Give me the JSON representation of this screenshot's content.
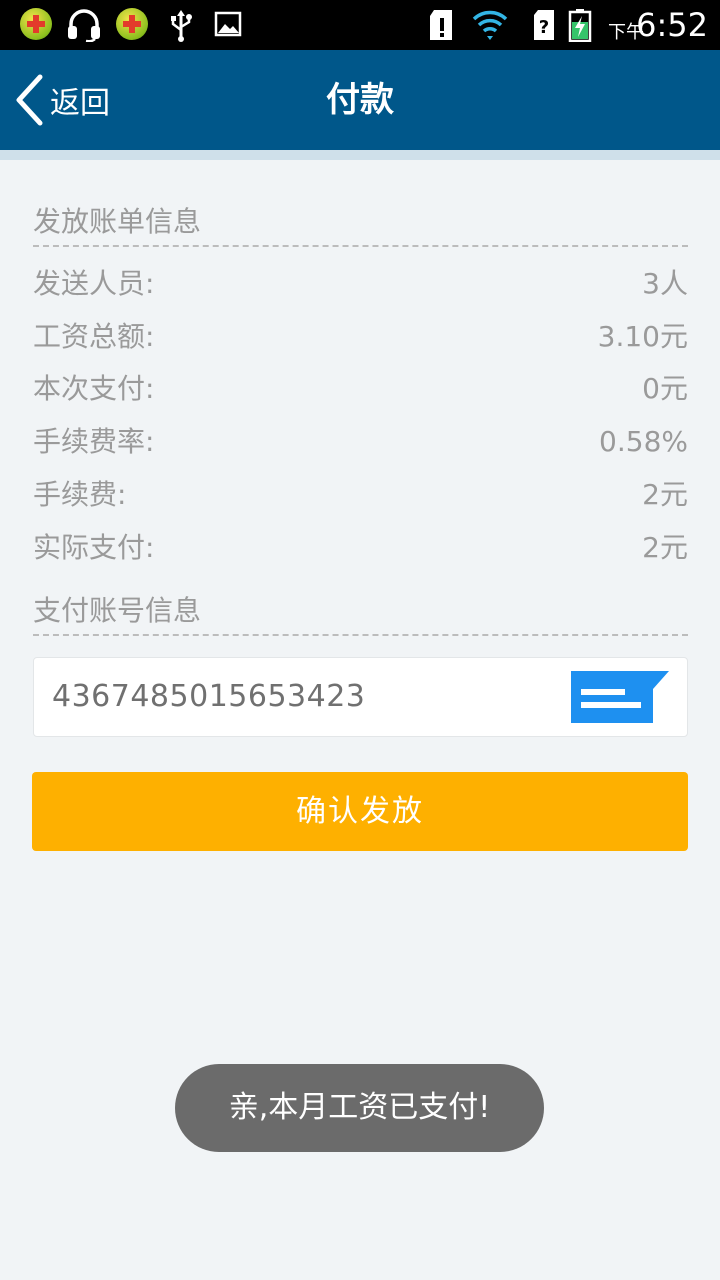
{
  "status_bar": {
    "ampm": "下午",
    "time": "6:52",
    "icons": [
      "app-plus-icon",
      "headset-icon",
      "app-plus-icon",
      "usb-icon",
      "image-icon",
      "sd-card-alert-icon",
      "wifi-icon",
      "no-sim-icon",
      "battery-charging-icon"
    ]
  },
  "nav": {
    "back_label": "返回",
    "title": "付款"
  },
  "bill_section": {
    "title": "发放账单信息",
    "rows": [
      {
        "label": "发送人员:",
        "value": "3人"
      },
      {
        "label": "工资总额:",
        "value": "3.10元"
      },
      {
        "label": "本次支付:",
        "value": "0元"
      },
      {
        "label": "手续费率:",
        "value": "0.58%"
      },
      {
        "label": "手续费:",
        "value": "2元"
      },
      {
        "label": "实际支付:",
        "value": "2元"
      }
    ]
  },
  "account_section": {
    "title": "支付账号信息",
    "account_number": "4367485015653423",
    "card_icon": "bank-card-icon"
  },
  "confirm_button": {
    "label": "确认发放"
  },
  "toast": {
    "message": "亲,本月工资已支付!"
  },
  "colors": {
    "nav_bg": "#00578a",
    "page_bg": "#f1f4f6",
    "button_bg": "#feb000",
    "card_icon": "#1e90f0",
    "toast_bg": "#6b6b6b"
  }
}
